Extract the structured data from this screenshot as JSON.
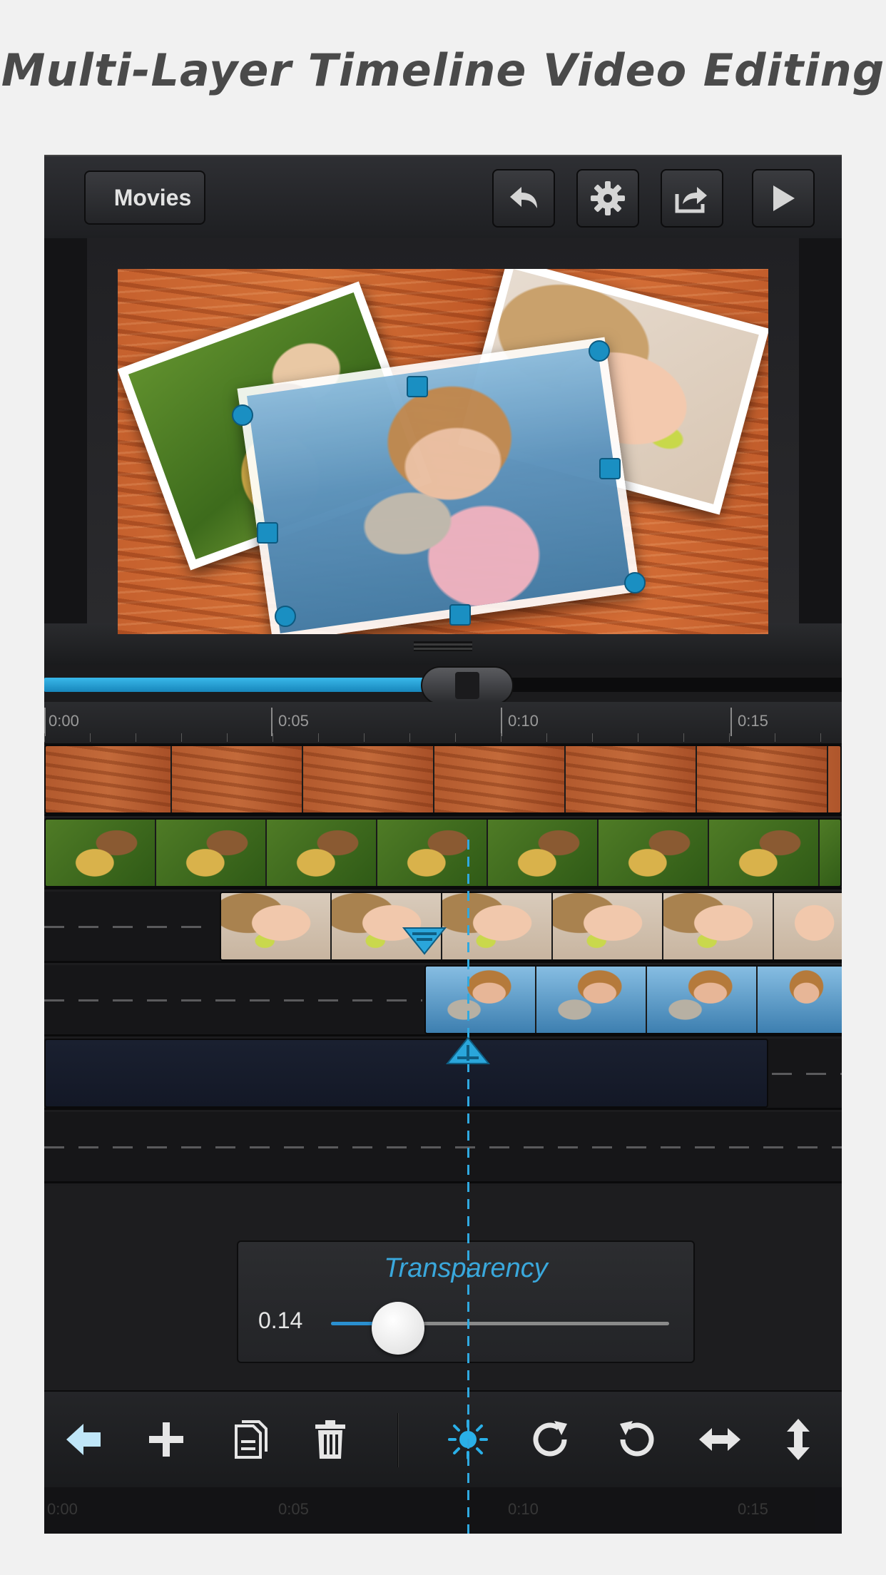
{
  "headline": "Multi-Layer Timeline Video Editing",
  "topbar": {
    "back_label": "Movies"
  },
  "ruler": {
    "ticks": [
      "0:00",
      "0:05",
      "0:10",
      "0:15"
    ]
  },
  "panel": {
    "title": "Transparency",
    "value": "0.14",
    "level": 0.14
  },
  "ghostbar": {
    "ticks": [
      "0:00",
      "0:05",
      "0:10",
      "0:15"
    ]
  },
  "colors": {
    "accent": "#2fa9e0",
    "wood": "#c6612e",
    "toolbar": "#242528"
  },
  "icons": {
    "undo": "undo-icon",
    "settings": "gear-icon",
    "share": "share-icon",
    "play": "play-icon",
    "back": "arrow-left-icon",
    "add": "plus-icon",
    "copy": "copy-icon",
    "delete": "trash-icon",
    "brightness": "sun-icon",
    "rotate_cw": "rotate-right-icon",
    "rotate_ccw": "rotate-left-icon",
    "flip_h": "flip-horizontal-icon",
    "flip_v": "flip-vertical-icon"
  }
}
